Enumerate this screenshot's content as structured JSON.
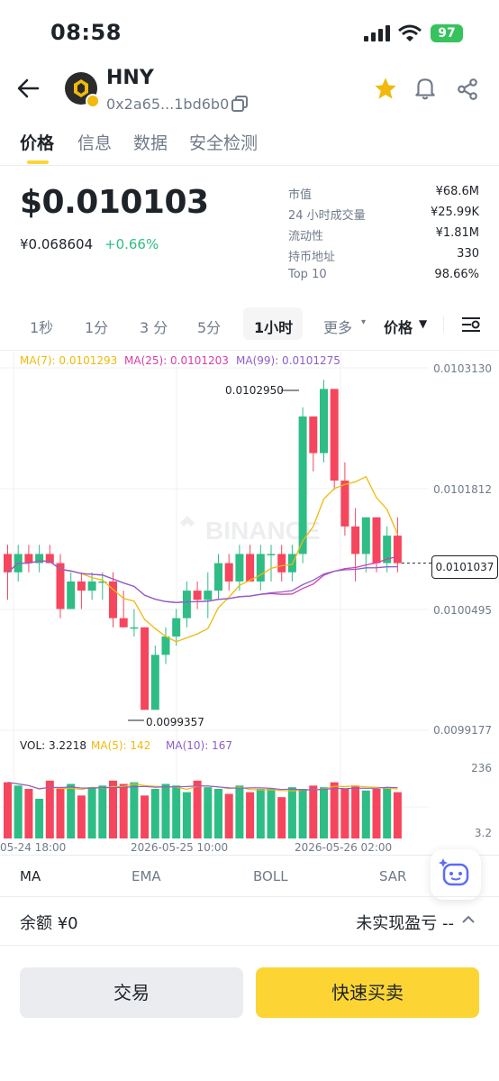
{
  "status_bar": {
    "time": "08:58",
    "battery": "97"
  },
  "header": {
    "name": "HNY",
    "address": "0x2a65...1bd6b0"
  },
  "tabs": [
    "价格",
    "信息",
    "数据",
    "安全检测"
  ],
  "price": {
    "usd": "$0.010103",
    "cny": "¥0.068604",
    "change": "+0.66%"
  },
  "stats": [
    {
      "label": "市值",
      "value": "¥68.6M"
    },
    {
      "label": "24 小时成交量",
      "value": "¥25.99K"
    },
    {
      "label": "流动性",
      "value": "¥1.81M"
    },
    {
      "label": "持币地址",
      "value": "330"
    },
    {
      "label": "Top 10",
      "value": "98.66%"
    }
  ],
  "intervals": [
    "1秒",
    "1分",
    "3 分",
    "5分",
    "1小时",
    "更多",
    "价格"
  ],
  "ma_legend": {
    "ma7": "MA(7): 0.0101293",
    "ma25": "MA(25): 0.0101203",
    "ma99": "MA(99): 0.0101275"
  },
  "y_axis": [
    "0.0103130",
    "0.0101812",
    "0.0100495",
    "0.0099177"
  ],
  "current_price_tag": "0.0101037",
  "high_label": "0.0102950",
  "low_label": "0.0099357",
  "watermark": "BINANCE",
  "vol_legend": {
    "vol": "VOL: 3.2218",
    "ma5": "MA(5): 142",
    "ma10": "MA(10): 167"
  },
  "vol_axis": [
    "236",
    "3.2"
  ],
  "time_axis": [
    "05-24 18:00",
    "2026-05-25 10:00",
    "2026-05-26 02:00"
  ],
  "indicators": [
    "MA",
    "EMA",
    "BOLL",
    "SAR"
  ],
  "balance": "余额 ¥0",
  "pnl": "未实现盈亏 --",
  "buttons": {
    "trade": "交易",
    "quick": "快速买卖"
  },
  "colors": {
    "up": "#2ebd85",
    "down": "#f6465d",
    "accent": "#fcd535",
    "ma7": "#f0b90b",
    "ma25": "#d63ea9",
    "ma99": "#8e5ec8"
  },
  "chart_data": {
    "type": "candlestick",
    "price_range": [
      0.0099177,
      0.010313
    ],
    "candles": [
      {
        "o": 0.01011,
        "c": 0.01009,
        "h": 0.01012,
        "l": 0.01006
      },
      {
        "o": 0.01009,
        "c": 0.01011,
        "h": 0.01012,
        "l": 0.01008
      },
      {
        "o": 0.01011,
        "c": 0.0101,
        "h": 0.01012,
        "l": 0.01009
      },
      {
        "o": 0.0101,
        "c": 0.01011,
        "h": 0.01012,
        "l": 0.01009
      },
      {
        "o": 0.01011,
        "c": 0.0101,
        "h": 0.01012,
        "l": 0.0101
      },
      {
        "o": 0.0101,
        "c": 0.01005,
        "h": 0.01011,
        "l": 0.01004
      },
      {
        "o": 0.01005,
        "c": 0.01008,
        "h": 0.01009,
        "l": 0.01005
      },
      {
        "o": 0.01008,
        "c": 0.01007,
        "h": 0.01009,
        "l": 0.01005
      },
      {
        "o": 0.01007,
        "c": 0.01008,
        "h": 0.01009,
        "l": 0.01006
      },
      {
        "o": 0.01008,
        "c": 0.01008,
        "h": 0.01009,
        "l": 0.01006
      },
      {
        "o": 0.01008,
        "c": 0.01004,
        "h": 0.01009,
        "l": 0.01003
      },
      {
        "o": 0.01004,
        "c": 0.01003,
        "h": 0.01007,
        "l": 0.01003
      },
      {
        "o": 0.01003,
        "c": 0.01003,
        "h": 0.01005,
        "l": 0.01002
      },
      {
        "o": 0.01003,
        "c": 0.00994,
        "h": 0.01003,
        "l": 0.00994
      },
      {
        "o": 0.00994,
        "c": 0.01,
        "h": 0.01001,
        "l": 0.00994
      },
      {
        "o": 0.01,
        "c": 0.01002,
        "h": 0.01003,
        "l": 0.00999
      },
      {
        "o": 0.01002,
        "c": 0.01004,
        "h": 0.01005,
        "l": 0.01001
      },
      {
        "o": 0.01004,
        "c": 0.01007,
        "h": 0.01008,
        "l": 0.01003
      },
      {
        "o": 0.01007,
        "c": 0.01006,
        "h": 0.01008,
        "l": 0.01005
      },
      {
        "o": 0.01006,
        "c": 0.01007,
        "h": 0.01009,
        "l": 0.01004
      },
      {
        "o": 0.01007,
        "c": 0.0101,
        "h": 0.01011,
        "l": 0.01006
      },
      {
        "o": 0.0101,
        "c": 0.01008,
        "h": 0.01011,
        "l": 0.01007
      },
      {
        "o": 0.01008,
        "c": 0.01011,
        "h": 0.01012,
        "l": 0.01007
      },
      {
        "o": 0.01011,
        "c": 0.01008,
        "h": 0.01012,
        "l": 0.01008
      },
      {
        "o": 0.01008,
        "c": 0.01011,
        "h": 0.01012,
        "l": 0.01007
      },
      {
        "o": 0.01011,
        "c": 0.01011,
        "h": 0.01012,
        "l": 0.01008
      },
      {
        "o": 0.01011,
        "c": 0.01009,
        "h": 0.01012,
        "l": 0.01008
      },
      {
        "o": 0.01009,
        "c": 0.01011,
        "h": 0.01012,
        "l": 0.01008
      },
      {
        "o": 0.01011,
        "c": 0.01026,
        "h": 0.01027,
        "l": 0.0101
      },
      {
        "o": 0.01026,
        "c": 0.01022,
        "h": 0.01026,
        "l": 0.0102
      },
      {
        "o": 0.01022,
        "c": 0.01029,
        "h": 0.0103,
        "l": 0.01021
      },
      {
        "o": 0.01029,
        "c": 0.01019,
        "h": 0.01029,
        "l": 0.01018
      },
      {
        "o": 0.01019,
        "c": 0.01014,
        "h": 0.01021,
        "l": 0.01013
      },
      {
        "o": 0.01014,
        "c": 0.01011,
        "h": 0.01016,
        "l": 0.01008
      },
      {
        "o": 0.01011,
        "c": 0.01015,
        "h": 0.01015,
        "l": 0.01009
      },
      {
        "o": 0.01015,
        "c": 0.0101,
        "h": 0.01015,
        "l": 0.01009
      },
      {
        "o": 0.0101,
        "c": 0.01013,
        "h": 0.01014,
        "l": 0.01009
      },
      {
        "o": 0.01013,
        "c": 0.0101,
        "h": 0.01015,
        "l": 0.01009
      }
    ],
    "volumes": [
      170,
      160,
      150,
      120,
      175,
      150,
      165,
      130,
      155,
      160,
      175,
      165,
      170,
      130,
      150,
      165,
      160,
      140,
      175,
      155,
      150,
      135,
      160,
      140,
      150,
      150,
      125,
      155,
      150,
      160,
      155,
      170,
      150,
      160,
      145,
      150,
      155,
      140
    ]
  }
}
